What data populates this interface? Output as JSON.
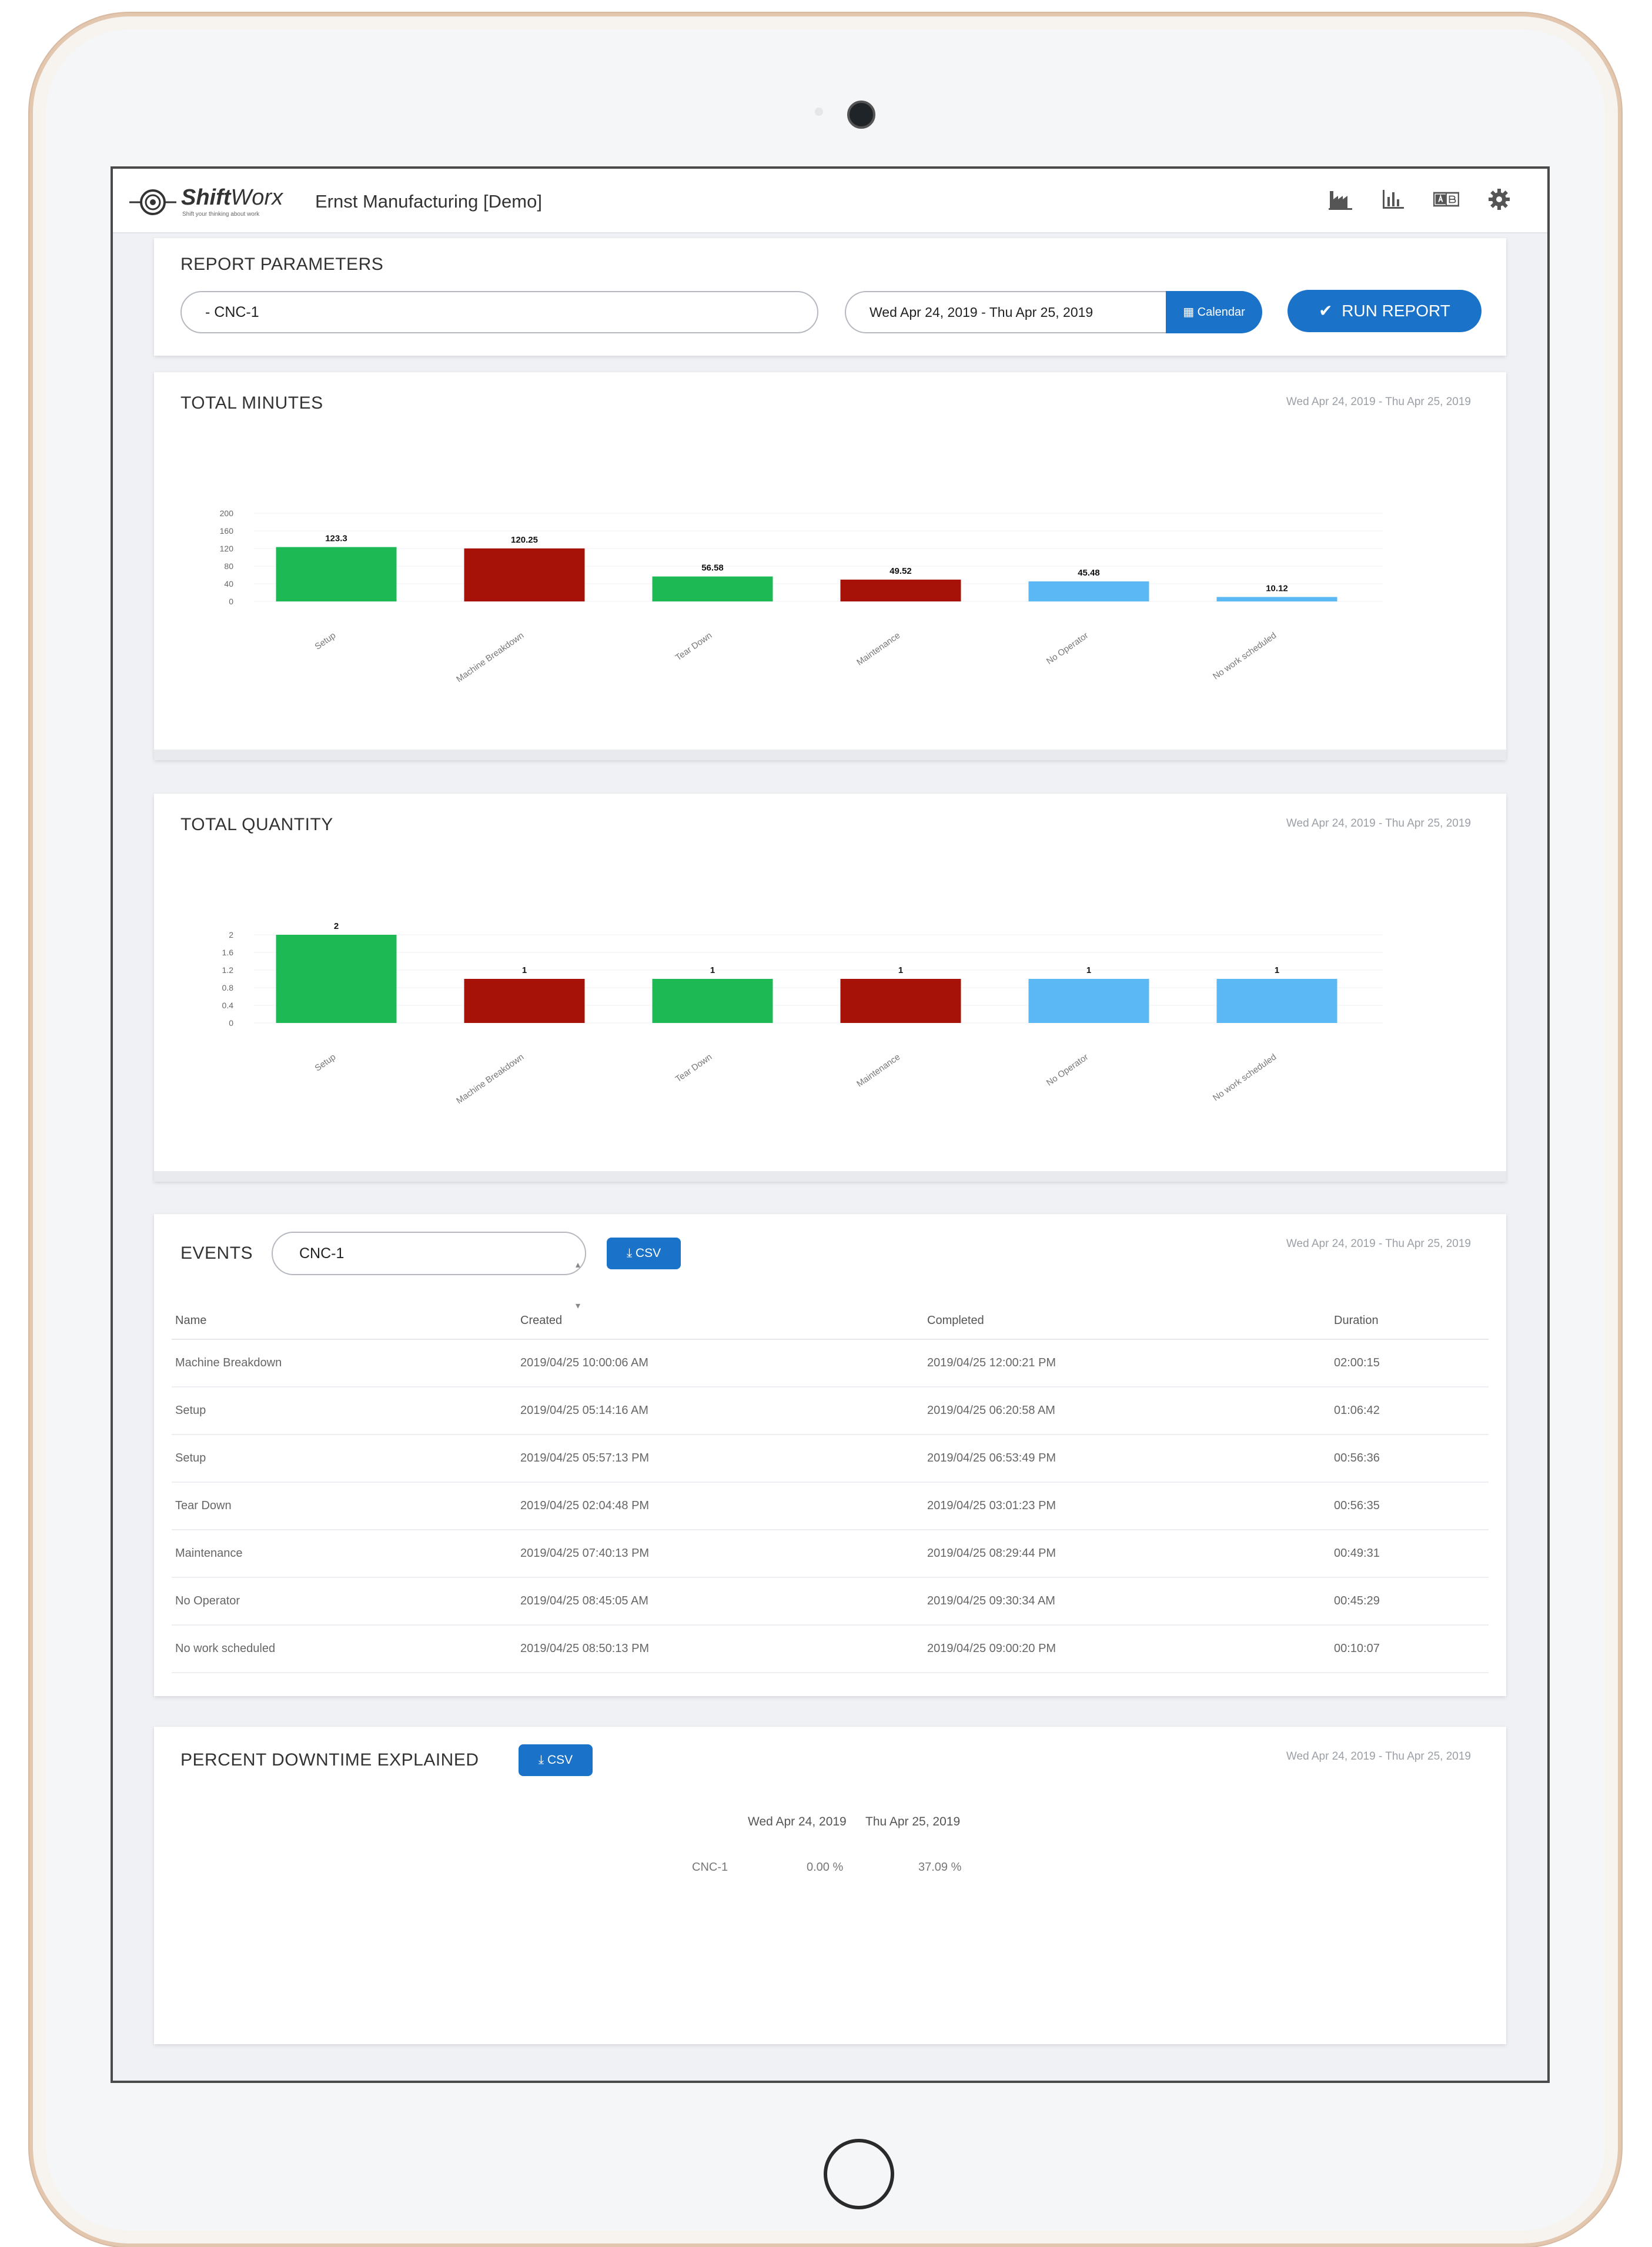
{
  "app": {
    "logo_text_bold": "Shift",
    "logo_text_light": "Worx",
    "logo_tagline": "Shift your thinking about work",
    "company": "Ernst Manufacturing [Demo]"
  },
  "report_parameters": {
    "title": "REPORT PARAMETERS",
    "machine_value": "- CNC-1",
    "date_range_value": "Wed Apr 24, 2019 - Thu Apr 25, 2019",
    "calendar_label": "Calendar",
    "run_label": "RUN REPORT"
  },
  "date_range_label": "Wed Apr 24, 2019 - Thu Apr 25, 2019",
  "total_minutes": {
    "title": "TOTAL MINUTES",
    "chart_data": {
      "type": "bar",
      "categories": [
        "Setup",
        "Machine Breakdown",
        "Tear Down",
        "Maintenance",
        "No Operator",
        "No work scheduled"
      ],
      "values": [
        123.3,
        120.25,
        56.58,
        49.52,
        45.48,
        10.12
      ],
      "value_labels": [
        "123.3",
        "120.25",
        "56.58",
        "49.52",
        "45.48",
        "10.12"
      ],
      "yticks": [
        "200",
        "160",
        "120",
        "80",
        "40",
        "0"
      ],
      "ylim": [
        0,
        200
      ],
      "colors": [
        "#1db954",
        "#a61207",
        "#1db954",
        "#a61207",
        "#5bb8f5",
        "#5bb8f5"
      ]
    }
  },
  "total_quantity": {
    "title": "TOTAL QUANTITY",
    "chart_data": {
      "type": "bar",
      "categories": [
        "Setup",
        "Machine Breakdown",
        "Tear Down",
        "Maintenance",
        "No Operator",
        "No work scheduled"
      ],
      "values": [
        2,
        1,
        1,
        1,
        1,
        1
      ],
      "value_labels": [
        "2",
        "1",
        "1",
        "1",
        "1",
        "1"
      ],
      "yticks": [
        "2",
        "1.6",
        "1.2",
        "0.8",
        "0.4",
        "0"
      ],
      "ylim": [
        0,
        2
      ],
      "colors": [
        "#1db954",
        "#a61207",
        "#1db954",
        "#a61207",
        "#5bb8f5",
        "#5bb8f5"
      ]
    }
  },
  "events": {
    "title": "EVENTS",
    "machine_value": "CNC-1",
    "csv_label": "CSV",
    "columns": [
      "Name",
      "Created",
      "Completed",
      "Duration"
    ],
    "rows": [
      [
        "Machine Breakdown",
        "2019/04/25 10:00:06 AM",
        "2019/04/25 12:00:21 PM",
        "02:00:15"
      ],
      [
        "Setup",
        "2019/04/25 05:14:16 AM",
        "2019/04/25 06:20:58 AM",
        "01:06:42"
      ],
      [
        "Setup",
        "2019/04/25 05:57:13 PM",
        "2019/04/25 06:53:49 PM",
        "00:56:36"
      ],
      [
        "Tear Down",
        "2019/04/25 02:04:48 PM",
        "2019/04/25 03:01:23 PM",
        "00:56:35"
      ],
      [
        "Maintenance",
        "2019/04/25 07:40:13 PM",
        "2019/04/25 08:29:44 PM",
        "00:49:31"
      ],
      [
        "No Operator",
        "2019/04/25 08:45:05 AM",
        "2019/04/25 09:30:34 AM",
        "00:45:29"
      ],
      [
        "No work scheduled",
        "2019/04/25 08:50:13 PM",
        "2019/04/25 09:00:20 PM",
        "00:10:07"
      ]
    ]
  },
  "percent_downtime": {
    "title": "PERCENT DOWNTIME EXPLAINED",
    "csv_label": "CSV",
    "columns": [
      "Wed Apr 24, 2019",
      "Thu Apr 25, 2019"
    ],
    "row_label": "CNC-1",
    "values": [
      "0.00 %",
      "37.09 %"
    ]
  }
}
